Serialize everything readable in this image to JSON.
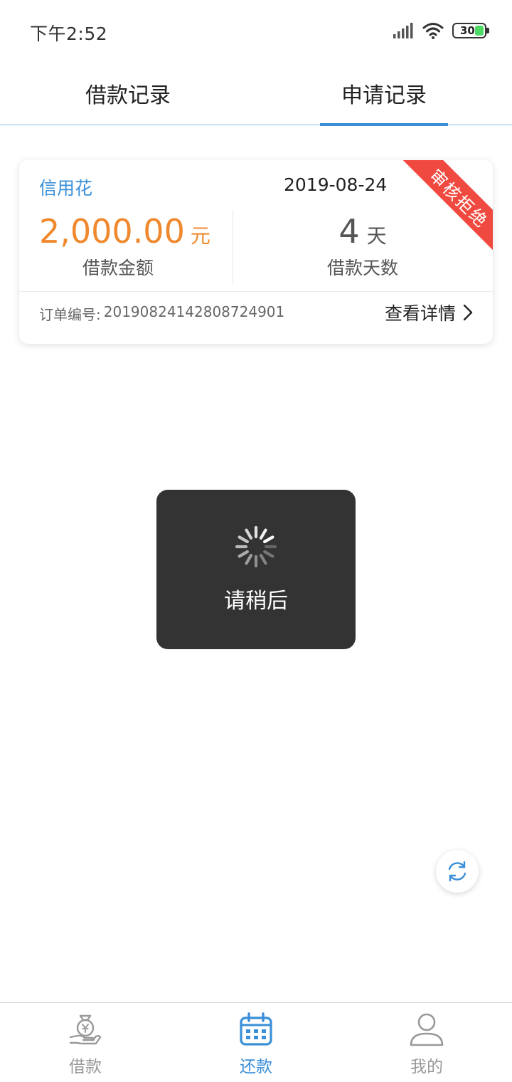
{
  "status_bar": {
    "time": "下午2:52",
    "battery": "30"
  },
  "tabs": [
    {
      "label": "借款记录",
      "active": false
    },
    {
      "label": "申请记录",
      "active": true
    }
  ],
  "record": {
    "product": "信用花",
    "date": "2019-08-24",
    "status": "审核拒绝",
    "amount": "2,000.00",
    "amount_unit": "元",
    "amount_label": "借款金额",
    "days": "4",
    "days_unit": "天",
    "days_label": "借款天数",
    "order_label": "订单编号:",
    "order_number": "20190824142808724901",
    "detail_link": "查看详情"
  },
  "loading": {
    "text": "请稍后"
  },
  "bottom_nav": [
    {
      "label": "借款",
      "icon": "money-bag-hand-icon",
      "active": false
    },
    {
      "label": "还款",
      "icon": "calendar-icon",
      "active": true
    },
    {
      "label": "我的",
      "icon": "user-icon",
      "active": false
    }
  ],
  "colors": {
    "accent": "#3a8fd8",
    "amount": "#f0892e",
    "ribbon": "#f04a40",
    "toast_bg": "#333333"
  }
}
